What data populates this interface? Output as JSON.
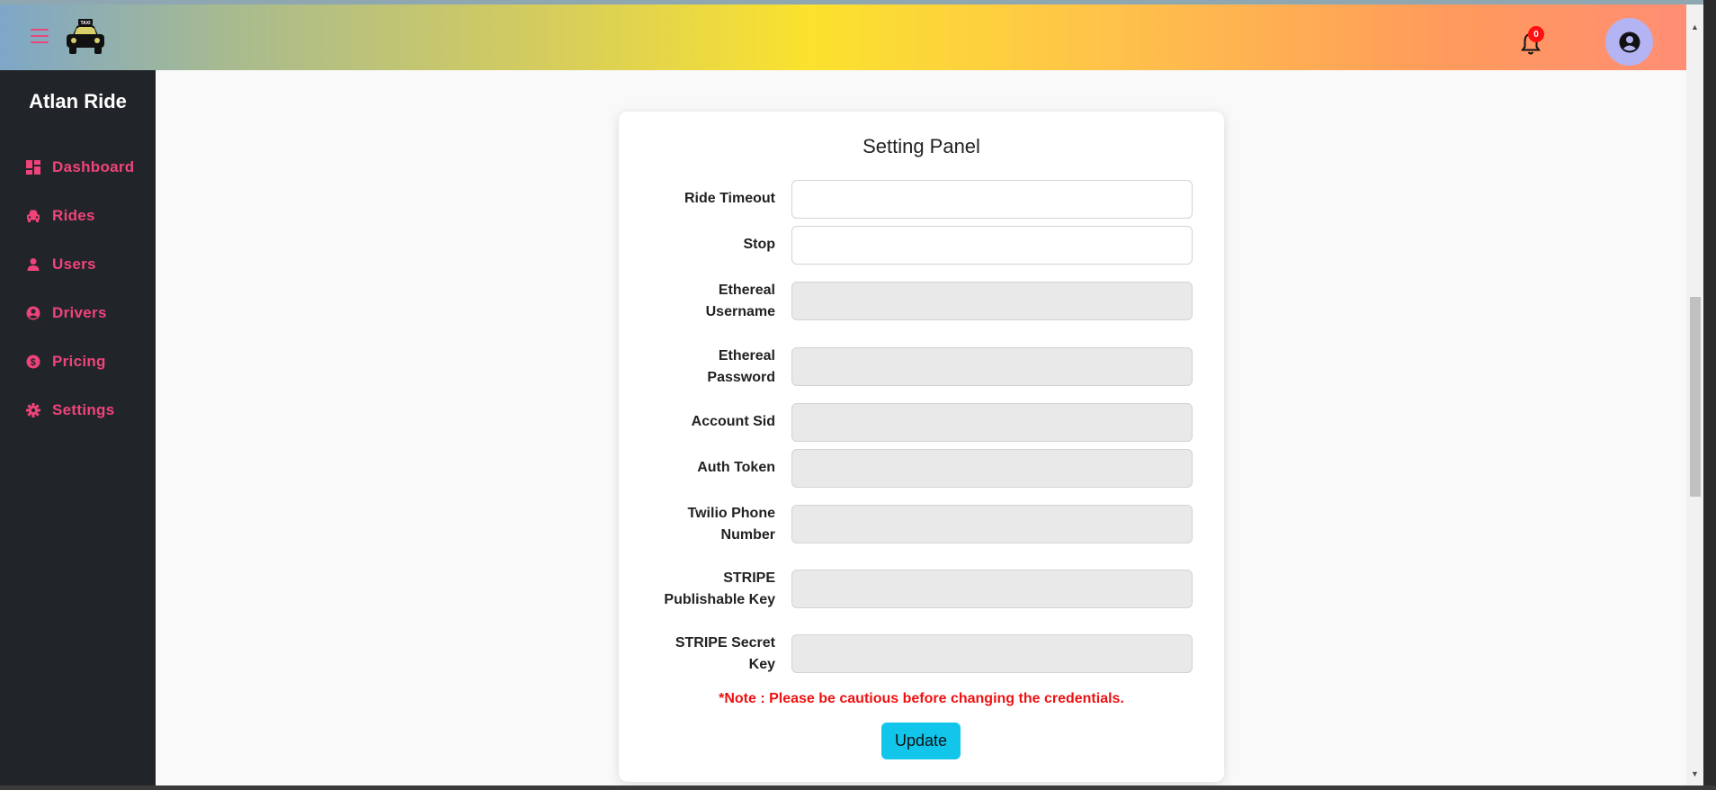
{
  "app": {
    "brand": "Atlan Ride",
    "logo_icon": "taxi-icon",
    "notifications_count": "0",
    "colors": {
      "accent": "#f0437a",
      "sidebar": "#212529",
      "button": "#11c6ea",
      "note": "#ee1111"
    }
  },
  "sidebar": {
    "items": [
      {
        "label": "Dashboard",
        "icon": "dashboard-icon"
      },
      {
        "label": "Rides",
        "icon": "car-icon"
      },
      {
        "label": "Users",
        "icon": "user-icon"
      },
      {
        "label": "Drivers",
        "icon": "user-circle-icon"
      },
      {
        "label": "Pricing",
        "icon": "dollar-circle-icon"
      },
      {
        "label": "Settings",
        "icon": "gear-icon"
      }
    ]
  },
  "panel": {
    "title": "Setting Panel",
    "fields": [
      {
        "label_line1": "Ride Timeout",
        "label_line2": "",
        "value": ""
      },
      {
        "label_line1": "Stop",
        "label_line2": "",
        "value": ""
      },
      {
        "label_line1": "Ethereal",
        "label_line2": "Username",
        "value": ""
      },
      {
        "label_line1": "Ethereal",
        "label_line2": "Password",
        "value": ""
      },
      {
        "label_line1": "Account Sid",
        "label_line2": "",
        "value": ""
      },
      {
        "label_line1": "Auth Token",
        "label_line2": "",
        "value": ""
      },
      {
        "label_line1": "Twilio Phone",
        "label_line2": "Number",
        "value": ""
      },
      {
        "label_line1": "STRIPE",
        "label_line2": "Publishable Key",
        "value": ""
      },
      {
        "label_line1": "STRIPE Secret",
        "label_line2": "Key",
        "value": ""
      }
    ],
    "note": "*Note : Please be cautious before changing the credentials.",
    "update_label": "Update"
  }
}
